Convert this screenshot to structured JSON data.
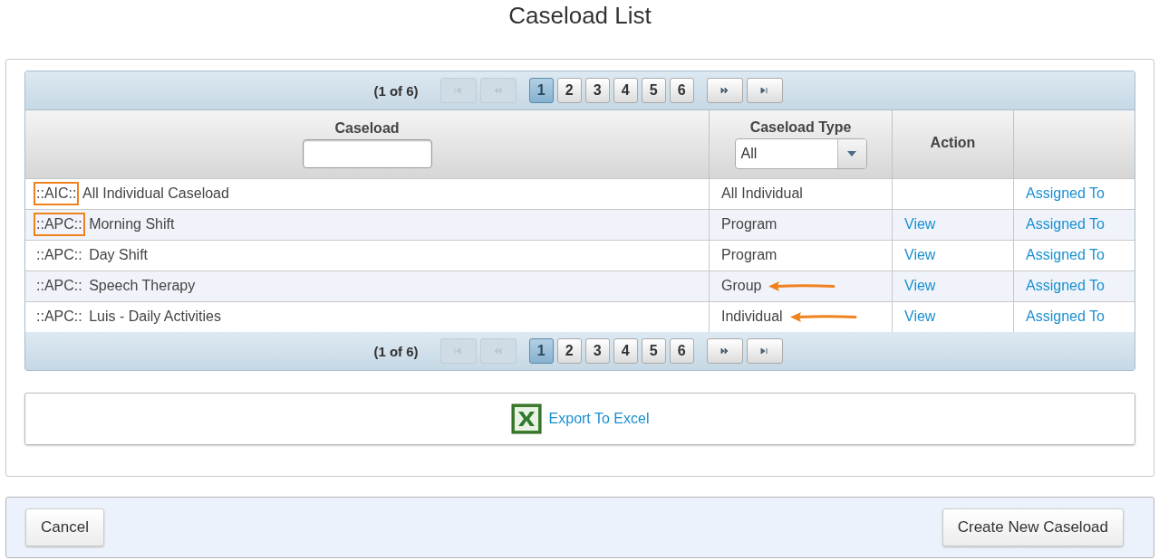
{
  "page_title": "Caseload List",
  "paginator_top": {
    "summary": "(1 of 6)",
    "first_disabled": true,
    "prev_disabled": true,
    "next_disabled": false,
    "last_disabled": false,
    "pages": [
      {
        "label": "1",
        "selected": true
      },
      {
        "label": "2",
        "selected": false
      },
      {
        "label": "3",
        "selected": false
      },
      {
        "label": "4",
        "selected": false
      },
      {
        "label": "5",
        "selected": false
      },
      {
        "label": "6",
        "selected": false
      }
    ]
  },
  "table": {
    "columns": [
      {
        "label": "Caseload",
        "kind": "text"
      },
      {
        "label": "Caseload Type",
        "kind": "select",
        "value": "All"
      },
      {
        "label": "Action",
        "kind": "plain"
      },
      {
        "kind": "plain"
      }
    ],
    "rows": [
      {
        "code": "::AIC::",
        "name": "All Individual Caseload",
        "code_highlighted": true,
        "type": "All Individual",
        "type_arrow": false,
        "action": "",
        "assigned": "Assigned To"
      },
      {
        "code": "::APC::",
        "name": "Morning Shift",
        "code_highlighted": true,
        "type": "Program",
        "type_arrow": false,
        "action": "View",
        "assigned": "Assigned To"
      },
      {
        "code": "::APC::",
        "name": "Day Shift",
        "code_highlighted": false,
        "type": "Program",
        "type_arrow": false,
        "action": "View",
        "assigned": "Assigned To"
      },
      {
        "code": "::APC::",
        "name": "Speech Therapy",
        "code_highlighted": false,
        "type": "Group",
        "type_arrow": true,
        "action": "View",
        "assigned": "Assigned To"
      },
      {
        "code": "::APC::",
        "name": "Luis - Daily Activities",
        "code_highlighted": false,
        "type": "Individual",
        "type_arrow": true,
        "action": "View",
        "assigned": "Assigned To"
      }
    ]
  },
  "paginator_bottom": {
    "summary": "(1 of 6)",
    "first_disabled": true,
    "prev_disabled": true,
    "next_disabled": false,
    "last_disabled": false,
    "pages": [
      {
        "label": "1",
        "selected": true
      },
      {
        "label": "2",
        "selected": false
      },
      {
        "label": "3",
        "selected": false
      },
      {
        "label": "4",
        "selected": false
      },
      {
        "label": "5",
        "selected": false
      },
      {
        "label": "6",
        "selected": false
      }
    ]
  },
  "export_link": "Export To Excel",
  "footer": {
    "buttons": [
      "Cancel",
      "Create New Caseload"
    ]
  }
}
